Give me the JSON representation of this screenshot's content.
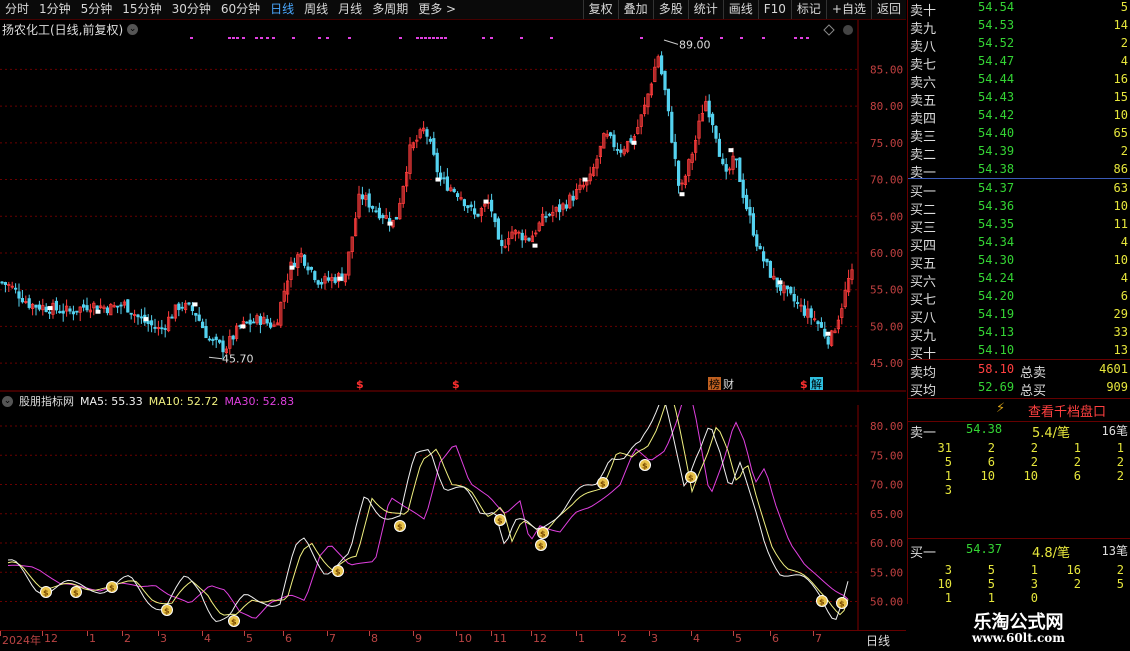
{
  "toolbar": {
    "periods": [
      "分时",
      "1分钟",
      "5分钟",
      "15分钟",
      "30分钟",
      "60分钟",
      "日线",
      "周线",
      "月线",
      "多周期",
      "更多 >"
    ],
    "active": "日线",
    "right_buttons": [
      "复权",
      "叠加",
      "多股",
      "统计",
      "画线",
      "F10",
      "标记",
      "+自选",
      "返回"
    ]
  },
  "main_chart": {
    "title": "扬农化工(日线,前复权)",
    "high_label": "89.00",
    "low_label": "45.70",
    "y_ticks": [
      "85.00",
      "80.00",
      "75.00",
      "70.00",
      "65.00",
      "60.00",
      "55.00",
      "50.00",
      "45.00"
    ],
    "markers": [
      "榜",
      "财",
      "$",
      "解"
    ]
  },
  "indicator": {
    "name": "股朋指标网",
    "ma5_label": "MA5: 55.33",
    "ma10_label": "MA10: 52.72",
    "ma30_label": "MA30: 52.83",
    "y_ticks": [
      "80.00",
      "75.00",
      "70.00",
      "65.00",
      "60.00",
      "55.00",
      "50.00"
    ],
    "colors": {
      "ma5": "#f0f0f0",
      "ma10": "#f0f080",
      "ma30": "#e040e0"
    }
  },
  "x_axis": {
    "labels": [
      "2024年",
      "12",
      "1",
      "2",
      "3",
      "4",
      "5",
      "6",
      "7",
      "8",
      "9",
      "10",
      "11",
      "12",
      "1",
      "2",
      "3",
      "4",
      "5",
      "6",
      "7"
    ],
    "period_label": "日线"
  },
  "order_book": {
    "sells": [
      {
        "name": "卖十",
        "price": "54.54",
        "vol": "5"
      },
      {
        "name": "卖九",
        "price": "54.53",
        "vol": "14"
      },
      {
        "name": "卖八",
        "price": "54.52",
        "vol": "2"
      },
      {
        "name": "卖七",
        "price": "54.47",
        "vol": "4"
      },
      {
        "name": "卖六",
        "price": "54.44",
        "vol": "16"
      },
      {
        "name": "卖五",
        "price": "54.43",
        "vol": "15"
      },
      {
        "name": "卖四",
        "price": "54.42",
        "vol": "10"
      },
      {
        "name": "卖三",
        "price": "54.40",
        "vol": "65"
      },
      {
        "name": "卖二",
        "price": "54.39",
        "vol": "2"
      },
      {
        "name": "卖一",
        "price": "54.38",
        "vol": "86"
      }
    ],
    "buys": [
      {
        "name": "买一",
        "price": "54.37",
        "vol": "63"
      },
      {
        "name": "买二",
        "price": "54.36",
        "vol": "10"
      },
      {
        "name": "买三",
        "price": "54.35",
        "vol": "11"
      },
      {
        "name": "买四",
        "price": "54.34",
        "vol": "4"
      },
      {
        "name": "买五",
        "price": "54.30",
        "vol": "10"
      },
      {
        "name": "买六",
        "price": "54.24",
        "vol": "4"
      },
      {
        "name": "买七",
        "price": "54.20",
        "vol": "6"
      },
      {
        "name": "买八",
        "price": "54.19",
        "vol": "29"
      },
      {
        "name": "买九",
        "price": "54.13",
        "vol": "33"
      },
      {
        "name": "买十",
        "price": "54.10",
        "vol": "13"
      }
    ],
    "avg_sell": {
      "label": "卖均",
      "price": "58.10",
      "total_label": "总卖",
      "total": "4601"
    },
    "avg_buy": {
      "label": "买均",
      "price": "52.69",
      "total_label": "总买",
      "total": "909"
    },
    "thousand_btn": "查看千档盘口",
    "sell1": {
      "label": "卖一",
      "price": "54.38",
      "avg": "5.4/笔",
      "count": "16笔"
    },
    "sell1_grid": [
      [
        "31",
        "2",
        "2",
        "1",
        "1"
      ],
      [
        "5",
        "6",
        "2",
        "2",
        "2"
      ],
      [
        "1",
        "10",
        "10",
        "6",
        "2"
      ],
      [
        "3",
        "",
        "",
        "",
        ""
      ]
    ],
    "buy1": {
      "label": "买一",
      "price": "54.37",
      "avg": "4.8/笔",
      "count": "13笔"
    },
    "buy1_grid": [
      [
        "3",
        "5",
        "1",
        "16",
        "2"
      ],
      [
        "10",
        "5",
        "3",
        "2",
        "5"
      ],
      [
        "1",
        "1",
        "0",
        "",
        ""
      ]
    ]
  },
  "watermark": {
    "title": "乐淘公式网",
    "url": "www.60lt.com"
  }
}
